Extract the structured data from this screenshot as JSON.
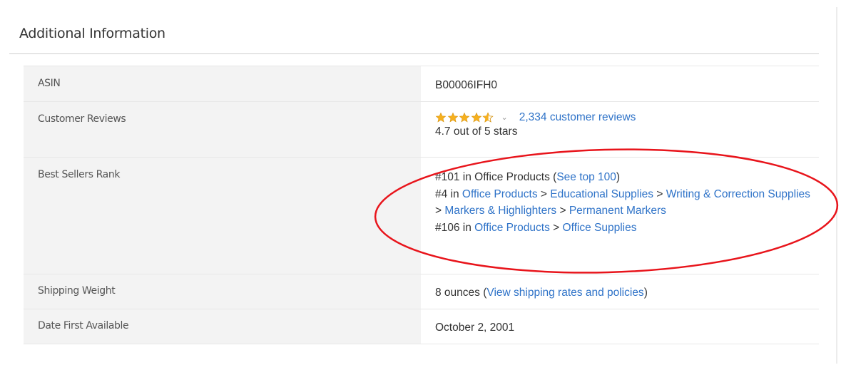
{
  "section": {
    "title": "Additional Information"
  },
  "rows": {
    "asin": {
      "label": "ASIN",
      "value": "B00006IFH0"
    },
    "reviews": {
      "label": "Customer Reviews",
      "rating": 4.7,
      "rating_max": 5,
      "reviews_link": "2,334 customer reviews",
      "rating_text": "4.7 out of 5 stars",
      "star_icons": [
        "star-full-icon",
        "star-full-icon",
        "star-full-icon",
        "star-full-icon",
        "star-half-icon"
      ],
      "chevron_icon": "chevron-down-icon"
    },
    "rank": {
      "label": "Best Sellers Rank",
      "line1_prefix": "#101 in Office Products (",
      "line1_link": "See top 100",
      "line1_suffix": ")",
      "line2_prefix": "#4 in ",
      "line2_links": [
        "Office Products",
        "Educational Supplies",
        "Writing & Correction Supplies",
        "Markers & Highlighters",
        "Permanent Markers"
      ],
      "separator": " > ",
      "line3_prefix": "#106 in ",
      "line3_links": [
        "Office Products",
        "Office Supplies"
      ]
    },
    "shipping": {
      "label": "Shipping Weight",
      "value_prefix": "8 ounces (",
      "value_link": "View shipping rates and policies",
      "value_suffix": ")"
    },
    "date": {
      "label": "Date First Available",
      "value": "October 2, 2001"
    }
  },
  "colors": {
    "link": "#2f73c8",
    "star": "#f6b01e",
    "annotation": "#e8141b",
    "label_bg": "#f3f3f3"
  },
  "annotation": {
    "shape": "ellipse",
    "target": "Best Sellers Rank value"
  }
}
